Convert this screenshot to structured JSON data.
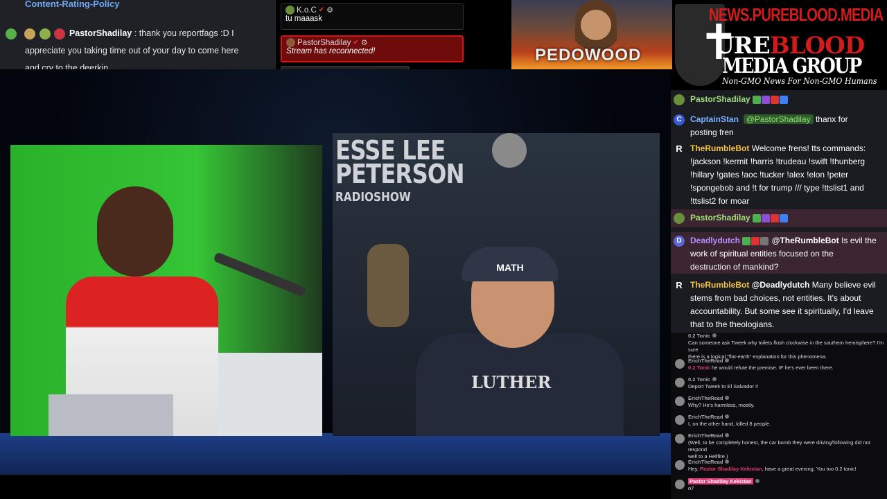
{
  "top_left_chat": {
    "policy_link": "Content-Rating-Policy",
    "message": {
      "username": "PastorShadilay",
      "text_line1": "thank you reportfags :D I",
      "text_line2": "appreciate you taking time out of your day to come here",
      "text_line3": "and cry to the deerkin"
    }
  },
  "mini_chat": [
    {
      "username": "K.o.C",
      "text": "tu maaask"
    },
    {
      "username": "PastorShadilay",
      "text": "Stream has reconnected!"
    }
  ],
  "promo": {
    "banner_text": "PEDOWOOD"
  },
  "logo": {
    "url_text": "NEWS.PUREBLOOD.MEDIA",
    "line1_a": "URE",
    "line1_b": "BLOOD",
    "line2": "MEDIA GROUP",
    "tagline": "Non-GMO News For Non-GMO Humans"
  },
  "video": {
    "show_brand_line1": "ESSE LEE",
    "show_brand_line2": "PETERSON",
    "show_brand_line3": "RADIOSHOW",
    "cap_text": "MATH",
    "hoodie_text": "LUTHER"
  },
  "chat": {
    "messages": [
      {
        "username": "PastorShadilay",
        "text": ""
      },
      {
        "username": "CaptainStan",
        "mention": "@PastorShadilay",
        "text": "thanx for",
        "text2": "posting fren"
      },
      {
        "username": "TheRumbleBot",
        "text": "Welcome frens! tts commands:",
        "lines": [
          "!jackson !kermit !harris !trudeau !swift !thunberg",
          "!hillary !gates !aoc !tucker !alex !elon !peter",
          "!spongebob and !t for trump /// type !ttslist1 and",
          "!ttslist2 for moar"
        ]
      },
      {
        "username": "PastorShadilay",
        "text": ""
      },
      {
        "username": "Deadlydutch",
        "mention": "@TheRumbleBot",
        "text": "Is evil the",
        "lines": [
          "work of spiritual entities focused on the",
          "destruction of mankind?"
        ]
      },
      {
        "username": "TheRumbleBot",
        "mention": "@Deadlydutch",
        "text": "Many believe evil",
        "lines": [
          "stems from bad choices, not entities. It's about",
          "accountability. But some see it spiritually, I'd leave",
          "that to the theologians."
        ]
      }
    ]
  },
  "chat2": {
    "messages": [
      {
        "username": "0.2 Tonic",
        "text": "Can someone ask Tweek why toilets flush clockwise in the southern hemisphere? I'm sure",
        "text2": "there is a logical \"flat-earth\" explanation for this phenomena."
      },
      {
        "username": "ErichTheRead",
        "mention": "0.2 Tonic",
        "text": "he would refute the premise. IF he's ever been there."
      },
      {
        "username": "0.2 Tonic",
        "text": "Deport Tweek to El Salvador !!"
      },
      {
        "username": "ErichTheRead",
        "text": "Why? He's harmless, mostly."
      },
      {
        "username": "ErichTheRead",
        "text": "I, on the other hand, killed 8 people."
      },
      {
        "username": "ErichTheRead",
        "text": "(Well, to be completely honest, the car bomb they were driving/following did not respond",
        "text2": "well to a Hellfire.)"
      },
      {
        "username": "ErichTheRead",
        "text": "Hey,",
        "mention": "Pastor Shadilay Kekistan",
        "text3": ", have a great evening. You too 0.2 tonic!"
      },
      {
        "username": "Pastor Shadilay Kekistan",
        "text": "o7"
      }
    ]
  },
  "colors": {
    "accent_red": "#d21b1b",
    "pastor_green": "#9fe07a",
    "bot_yellow": "#f5c242",
    "captain_blue": "#7ab2ff",
    "deadly_purple": "#b98cff"
  }
}
